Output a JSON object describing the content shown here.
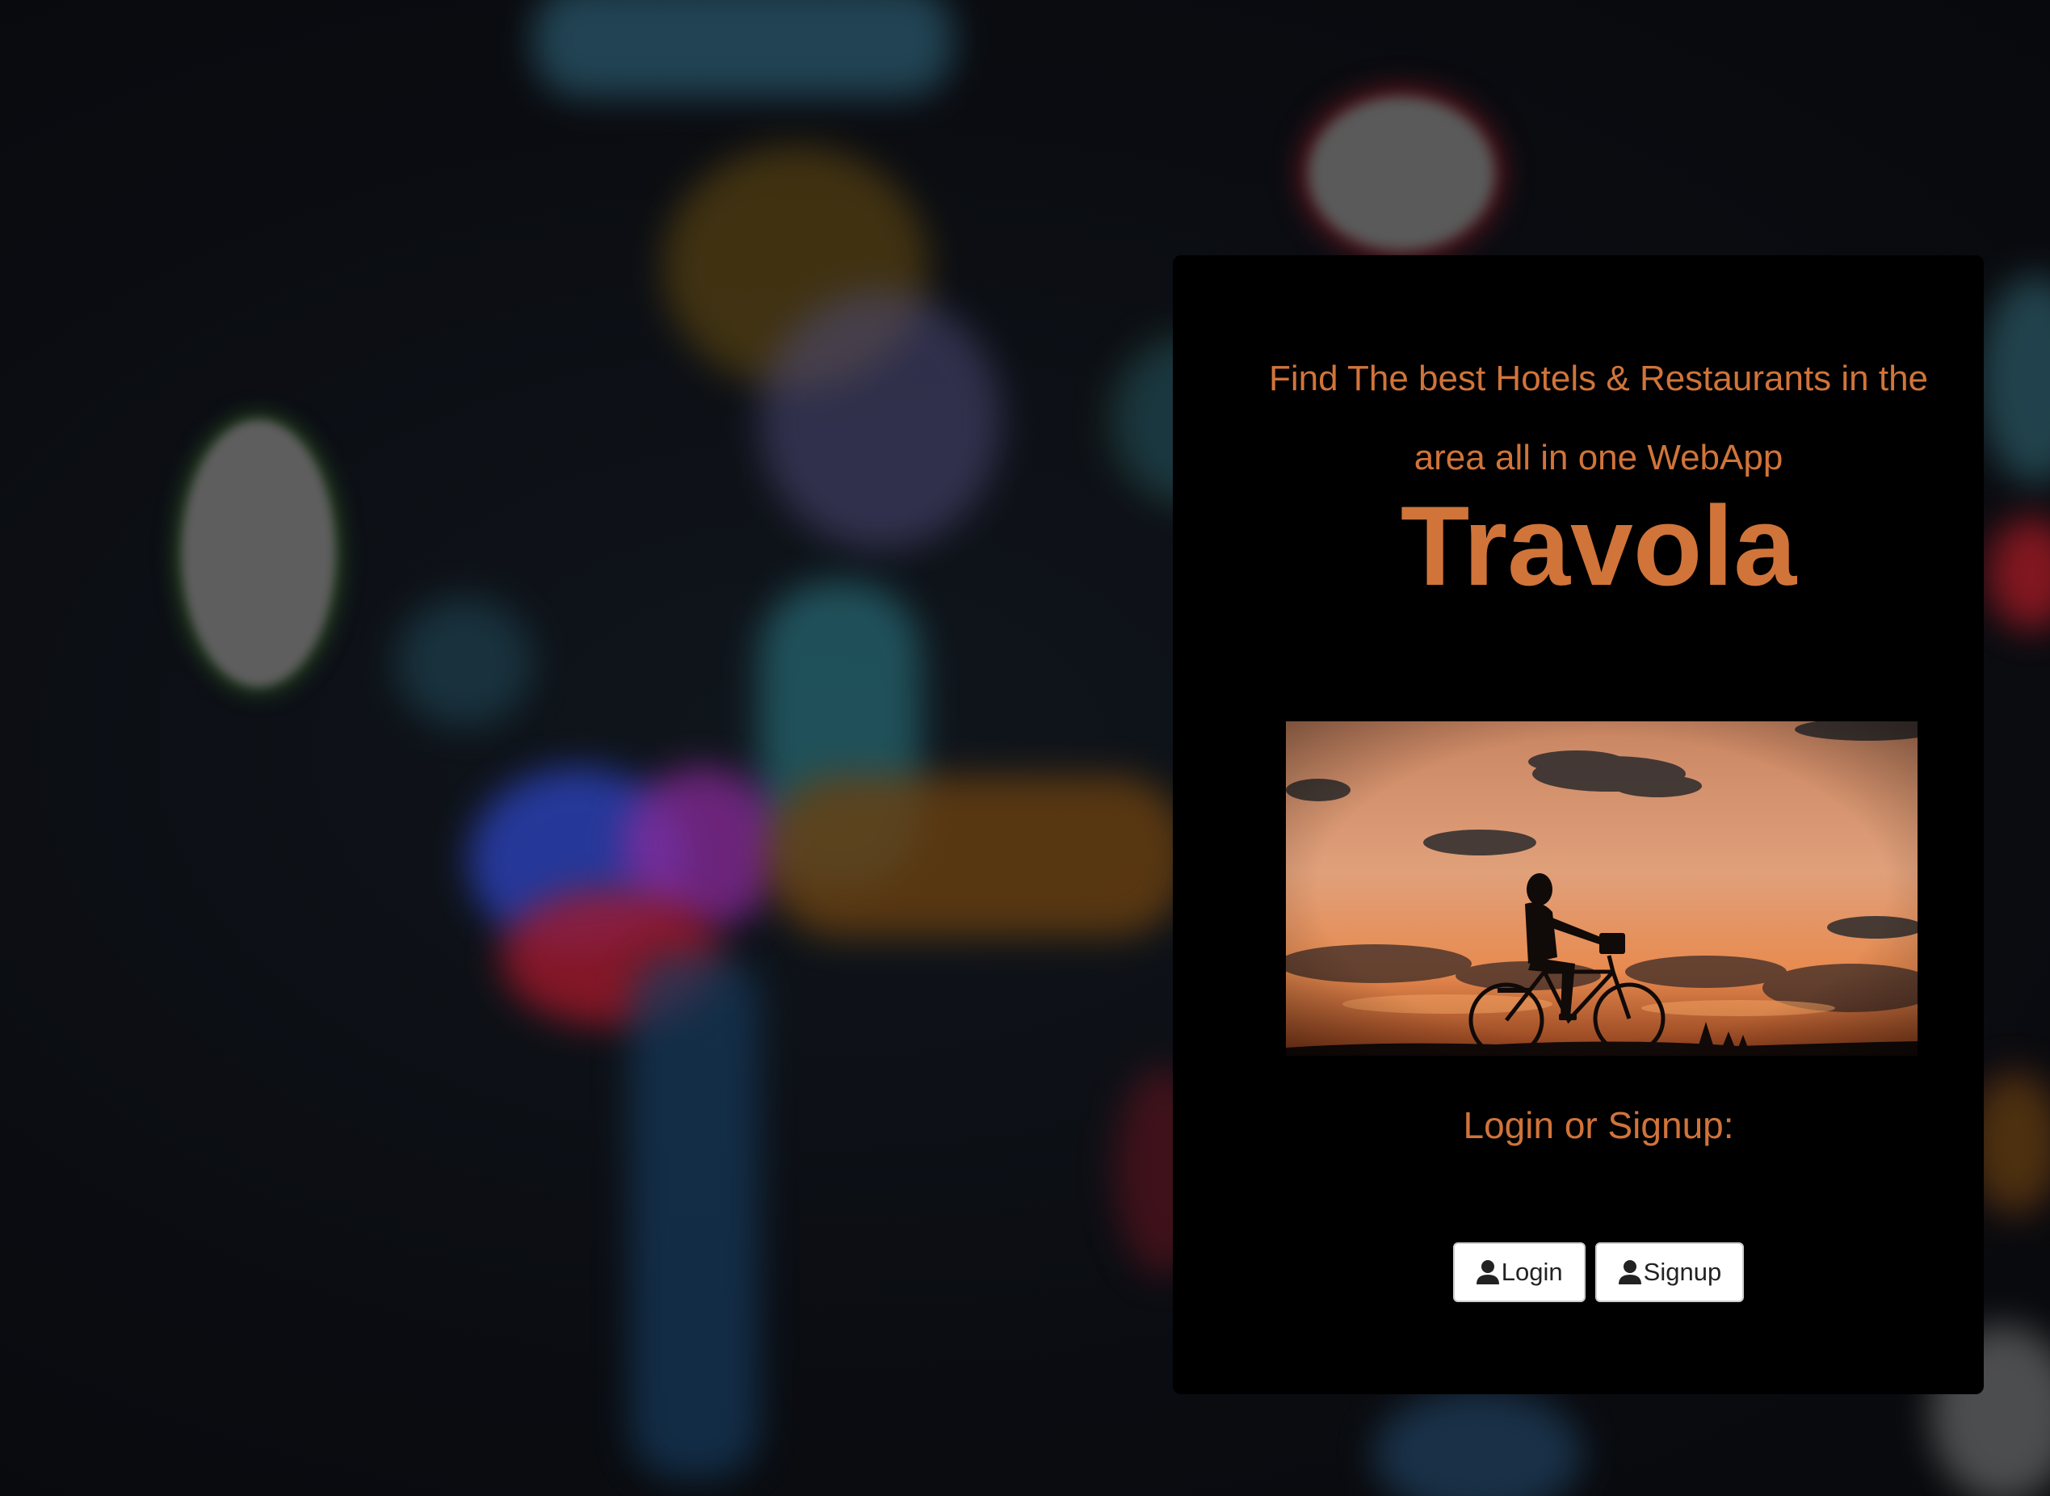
{
  "hero": {
    "tagline": "Find The best Hotels & Restaurants in the area all in one WebApp",
    "brand_name": "Travola",
    "image_alt": "Cyclist silhouette at sunset"
  },
  "auth": {
    "prompt": "Login or Signup:",
    "login_label": "Login",
    "signup_label": "Signup",
    "button_icon": "user-icon"
  },
  "colors": {
    "accent": "#d0743a",
    "card_background": "#000000",
    "button_background": "#ffffff"
  }
}
